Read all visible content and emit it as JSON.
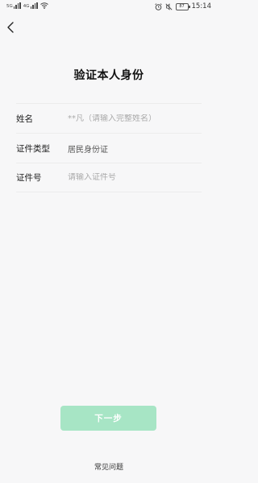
{
  "status_bar": {
    "network_tag_1": "5G",
    "network_tag_2": "4G",
    "battery": "87",
    "time": "15:14"
  },
  "icons": {
    "back": "chevron-left-icon",
    "wifi": "wifi-icon",
    "alarm": "alarm-icon",
    "mute": "mute-icon"
  },
  "page": {
    "title": "验证本人身份"
  },
  "form": {
    "name_label": "姓名",
    "name_placeholder": "**凡（请输入完整姓名）",
    "id_type_label": "证件类型",
    "id_type_value": "居民身份证",
    "id_number_label": "证件号",
    "id_number_placeholder": "请输入证件号"
  },
  "actions": {
    "next_label": "下一步",
    "next_color": "#a7e5c5",
    "faq_label": "常见问题"
  }
}
